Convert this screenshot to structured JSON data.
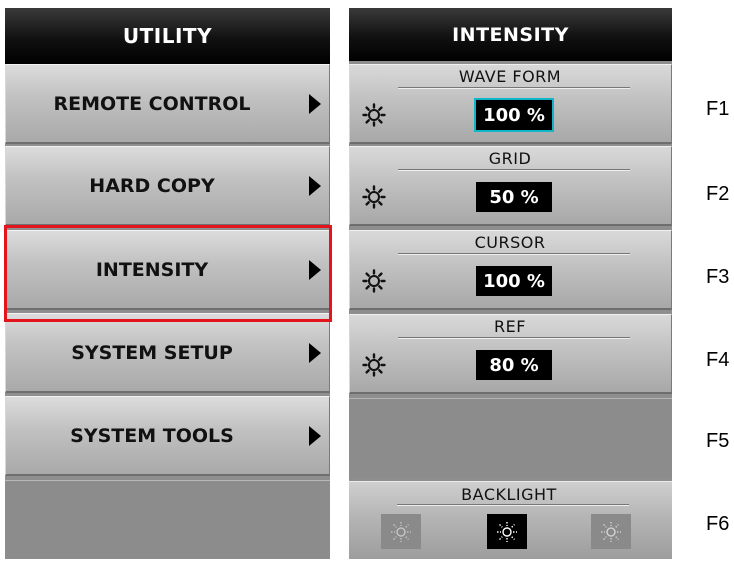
{
  "utility": {
    "title": "UTILITY",
    "items": [
      {
        "label": "REMOTE CONTROL"
      },
      {
        "label": "HARD COPY"
      },
      {
        "label": "INTENSITY",
        "selected": true
      },
      {
        "label": "SYSTEM SETUP"
      },
      {
        "label": "SYSTEM TOOLS"
      }
    ]
  },
  "intensity": {
    "title": "INTENSITY",
    "params": [
      {
        "label": "WAVE FORM",
        "value": "100 %",
        "active": true
      },
      {
        "label": "GRID",
        "value": "50 %"
      },
      {
        "label": "CURSOR",
        "value": "100 %"
      },
      {
        "label": "REF",
        "value": "80 %"
      }
    ],
    "backlight": {
      "label": "BACKLIGHT",
      "levels": [
        "low",
        "medium",
        "high"
      ],
      "selected": "medium"
    }
  },
  "function_keys": [
    "F1",
    "F2",
    "F3",
    "F4",
    "F5",
    "F6"
  ],
  "colors": {
    "highlight": "#e3141b",
    "active_value_outline": "#12b5c8"
  },
  "icons": {
    "param": "brightness-icon",
    "arrow": "right-arrow-icon"
  }
}
